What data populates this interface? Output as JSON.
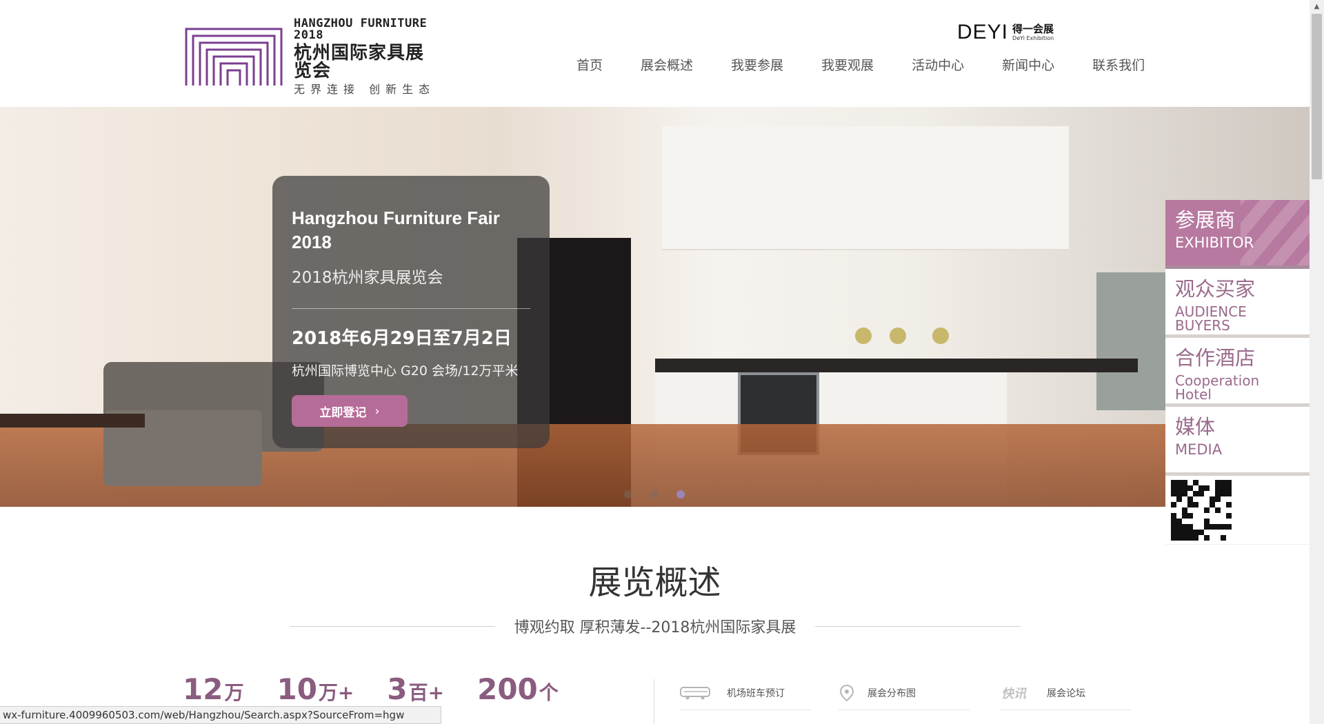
{
  "header": {
    "logo": {
      "en": "HANGZHOU FURNITURE 2018",
      "cn": "杭州国际家具展览会",
      "slogan": "无界连接  创新生态"
    },
    "deyi": {
      "big": "DEYI",
      "cn": "得一会展",
      "en": "DeYi Exhibition"
    }
  },
  "nav": {
    "items": [
      {
        "label": "首页"
      },
      {
        "label": "展会概述"
      },
      {
        "label": "我要参展"
      },
      {
        "label": "我要观展"
      },
      {
        "label": "活动中心"
      },
      {
        "label": "新闻中心"
      },
      {
        "label": "联系我们"
      }
    ]
  },
  "hero": {
    "title": "Hangzhou Furniture Fair 2018",
    "subtitle": "2018杭州家具展览会",
    "date": "2018年6月29日至7月2日",
    "venue": "杭州国际博览中心  G20 会场/12万平米",
    "button_label": "立即登记",
    "button_icon": "chevron-right-icon",
    "slides": {
      "count": 3,
      "active": 3
    }
  },
  "side": {
    "items": [
      {
        "cn": "参展商",
        "en": "EXHIBITOR",
        "active": true
      },
      {
        "cn": "观众买家",
        "en": "AUDIENCE BUYERS",
        "active": false
      },
      {
        "cn": "合作酒店",
        "en": "Cooperation Hotel",
        "active": false
      },
      {
        "cn": "媒体",
        "en": "MEDIA",
        "active": false
      }
    ],
    "qr_icon": "qr-code-icon"
  },
  "overview": {
    "title": "展览概述",
    "subtitle": "博观约取 厚积薄发--2018杭州国际家具展",
    "stats": [
      {
        "num": "12",
        "unit": "万"
      },
      {
        "num": "10",
        "unit": "万+"
      },
      {
        "num": "3",
        "unit": "百+"
      },
      {
        "num": "200",
        "unit": "个"
      }
    ],
    "links": [
      {
        "label": "机场班车预订",
        "icon": "bus-icon"
      },
      {
        "label": "展会分布图",
        "icon": "map-pin-icon"
      },
      {
        "label": "展会论坛",
        "icon": "news-flash-icon"
      }
    ]
  },
  "statusbar": {
    "url": "wx-furniture.4009960503.com/web/Hangzhou/Search.aspx?SourceFrom=hgw"
  },
  "colors": {
    "accent": "#b66c98",
    "accent_dark": "#8a5c7f",
    "side_active": "#b7799f"
  }
}
